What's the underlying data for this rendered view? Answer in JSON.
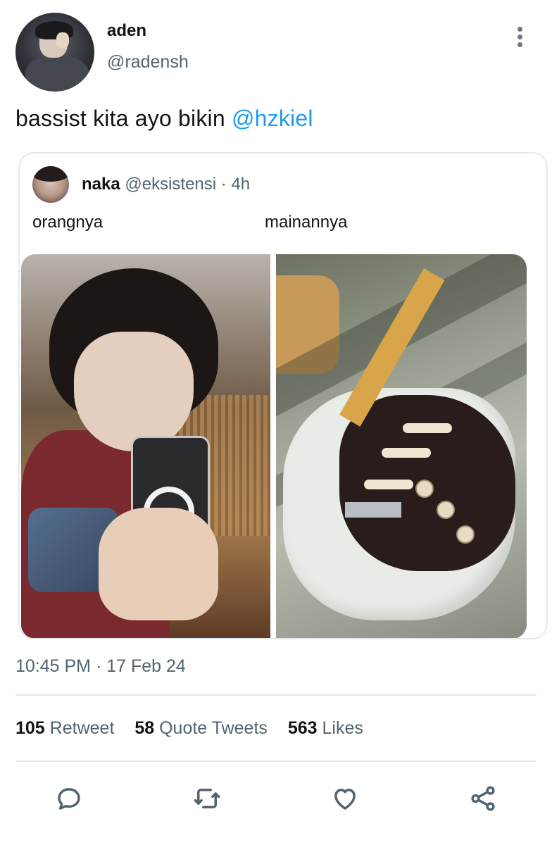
{
  "author": {
    "name": "aden",
    "handle": "@radensh"
  },
  "tweet": {
    "text": "bassist kita ayo bikin ",
    "mention": "@hzkiel"
  },
  "quoted": {
    "name": "naka",
    "handle": "@eksistensi",
    "separator": " · ",
    "time": "4h",
    "label_left": "orangnya",
    "label_right": "mainannya"
  },
  "meta": {
    "timestamp": "10:45 PM · 17 Feb 24"
  },
  "stats": {
    "retweets": "105",
    "retweets_label": "Retweet",
    "quotes": "58",
    "quotes_label": "Quote Tweets",
    "likes": "563",
    "likes_label": "Likes"
  },
  "icons": {
    "more": "more-vertical-icon",
    "reply": "reply-icon",
    "retweet": "retweet-icon",
    "like": "heart-icon",
    "share": "share-icon"
  },
  "colors": {
    "accent": "#1d9bf0",
    "text": "#0f1419",
    "secondary": "#536471",
    "border": "#e5e9ec"
  }
}
